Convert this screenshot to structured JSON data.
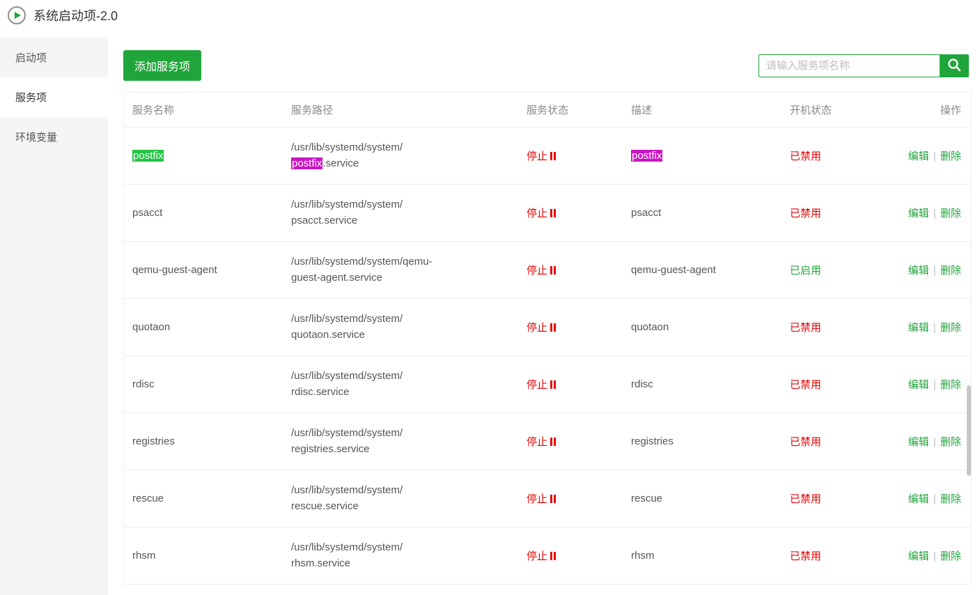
{
  "header": {
    "title": "系统启动项-2.0"
  },
  "sidebar": {
    "items": [
      {
        "label": "启动项"
      },
      {
        "label": "服务项"
      },
      {
        "label": "环境变量"
      }
    ],
    "activeIndex": 1
  },
  "toolbar": {
    "add_label": "添加服务项",
    "search_placeholder": "请输入服务项名称"
  },
  "table": {
    "headers": {
      "name": "服务名称",
      "path": "服务路径",
      "state": "服务状态",
      "desc": "描述",
      "boot": "开机状态",
      "op": "操作"
    },
    "status_labels": {
      "stopped": "停止"
    },
    "boot_labels": {
      "enabled": "已启用",
      "disabled": "已禁用"
    },
    "op_labels": {
      "edit": "编辑",
      "delete": "删除",
      "sep": " | "
    },
    "highlight_term": "postfix",
    "rows": [
      {
        "name": "postfix",
        "path": "/usr/lib/systemd/system/postfix.service",
        "state": "stopped",
        "desc": "postfix",
        "boot": "disabled"
      },
      {
        "name": "psacct",
        "path": "/usr/lib/systemd/system/psacct.service",
        "state": "stopped",
        "desc": "psacct",
        "boot": "disabled"
      },
      {
        "name": "qemu-guest-agent",
        "path": "/usr/lib/systemd/system/qemu-guest-agent.service",
        "state": "stopped",
        "desc": "qemu-guest-agent",
        "boot": "enabled"
      },
      {
        "name": "quotaon",
        "path": "/usr/lib/systemd/system/quotaon.service",
        "state": "stopped",
        "desc": "quotaon",
        "boot": "disabled"
      },
      {
        "name": "rdisc",
        "path": "/usr/lib/systemd/system/rdisc.service",
        "state": "stopped",
        "desc": "rdisc",
        "boot": "disabled"
      },
      {
        "name": "registries",
        "path": "/usr/lib/systemd/system/registries.service",
        "state": "stopped",
        "desc": "registries",
        "boot": "disabled"
      },
      {
        "name": "rescue",
        "path": "/usr/lib/systemd/system/rescue.service",
        "state": "stopped",
        "desc": "rescue",
        "boot": "disabled"
      },
      {
        "name": "rhsm",
        "path": "/usr/lib/systemd/system/rhsm.service",
        "state": "stopped",
        "desc": "rhsm",
        "boot": "disabled"
      }
    ]
  }
}
